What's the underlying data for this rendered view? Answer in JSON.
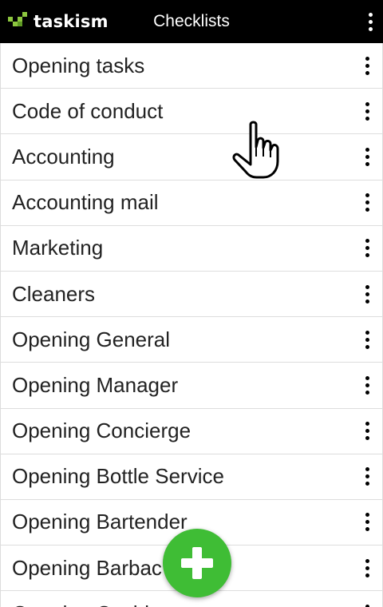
{
  "app": {
    "logo_text": "taskism",
    "title": "Checklists"
  },
  "icons": {
    "logo": "taskism-logo-mark",
    "top_menu": "more-vert-icon",
    "row_menu": "more-vert-icon",
    "fab": "plus-icon",
    "cursor": "pointing-hand-icon"
  },
  "colors": {
    "topbar_bg": "#000000",
    "accent_green": "#3fbd35",
    "logo_green": "#8dc63f"
  },
  "checklists": [
    {
      "label": "Opening tasks"
    },
    {
      "label": "Code of conduct"
    },
    {
      "label": "Accounting"
    },
    {
      "label": "Accounting mail"
    },
    {
      "label": "Marketing"
    },
    {
      "label": "Cleaners"
    },
    {
      "label": "Opening General"
    },
    {
      "label": "Opening Manager"
    },
    {
      "label": "Opening Concierge"
    },
    {
      "label": "Opening Bottle Service"
    },
    {
      "label": "Opening Bartender"
    },
    {
      "label": "Opening Barbac"
    },
    {
      "label": "Opening Cashier"
    }
  ]
}
